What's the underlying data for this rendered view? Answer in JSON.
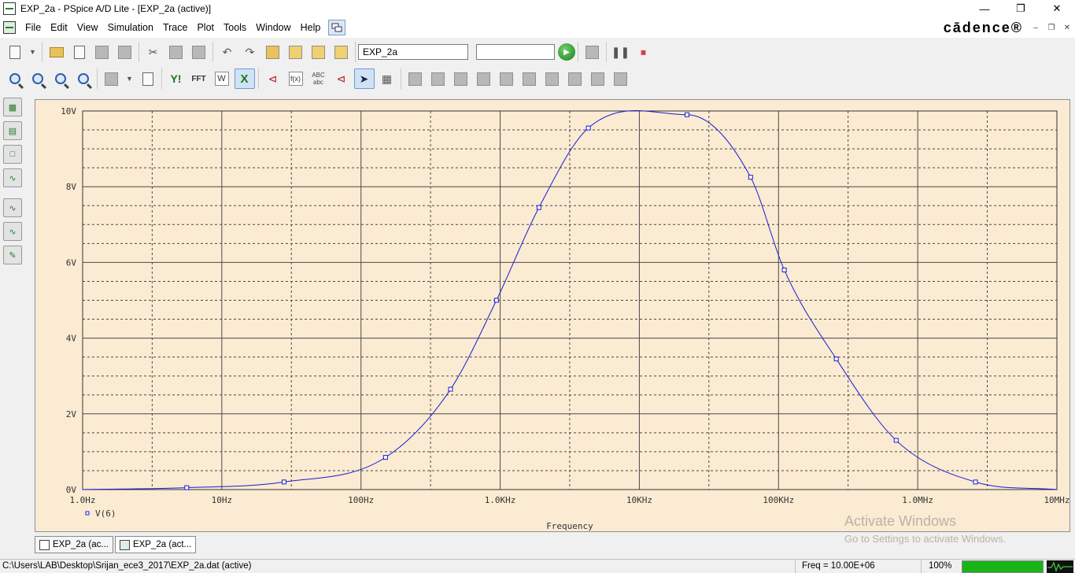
{
  "window": {
    "title": "EXP_2a - PSpice A/D Lite - [EXP_2a (active)]",
    "minimize": "—",
    "restore": "❐",
    "close": "✕"
  },
  "menu": {
    "items": [
      "File",
      "Edit",
      "View",
      "Simulation",
      "Trace",
      "Plot",
      "Tools",
      "Window",
      "Help"
    ],
    "brand": "cādence®",
    "mdi_minimize": "–",
    "mdi_restore": "❐",
    "mdi_close": "✕"
  },
  "toolbar": {
    "profile_value": "EXP_2a",
    "section_value": "",
    "run_icon": "play-icon"
  },
  "chart_data": {
    "type": "line",
    "title": "",
    "xlabel": "Frequency",
    "ylabel": "",
    "x_scale": "log",
    "xlim": [
      1,
      10000000
    ],
    "ylim": [
      0,
      10
    ],
    "x_ticks": [
      1,
      10,
      100,
      1000,
      10000,
      100000,
      1000000,
      10000000
    ],
    "x_tick_labels": [
      "1.0Hz",
      "10Hz",
      "100Hz",
      "1.0KHz",
      "10KHz",
      "100KHz",
      "1.0MHz",
      "10MHz"
    ],
    "y_ticks": [
      0,
      2,
      4,
      6,
      8,
      10
    ],
    "y_tick_labels": [
      "0V",
      "2V",
      "4V",
      "6V",
      "8V",
      "10V"
    ],
    "grid": true,
    "legend": "bottom-left",
    "series": [
      {
        "name": "V(6)",
        "color": "#1a1ad4",
        "marker": "square",
        "x": [
          1,
          5.6,
          28,
          150,
          440,
          940,
          1900,
          4300,
          22000,
          63000,
          110000,
          260000,
          700000,
          2600000,
          10000000
        ],
        "y": [
          0.0,
          0.05,
          0.2,
          0.85,
          2.65,
          5.0,
          7.45,
          9.55,
          9.9,
          8.25,
          5.8,
          3.45,
          1.3,
          0.2,
          0.0
        ]
      }
    ]
  },
  "tabs": [
    {
      "label": "EXP_2a (ac..."
    },
    {
      "label": "EXP_2a (act..."
    }
  ],
  "status": {
    "path": "C:\\Users\\LAB\\Desktop\\Srijan_ece3_2017\\EXP_2a.dat (active)",
    "freq": "Freq = 10.00E+06",
    "zoom": "100%",
    "progress": 1.0
  },
  "watermark": {
    "line1": "Activate Windows",
    "line2": "Go to Settings to activate Windows."
  }
}
